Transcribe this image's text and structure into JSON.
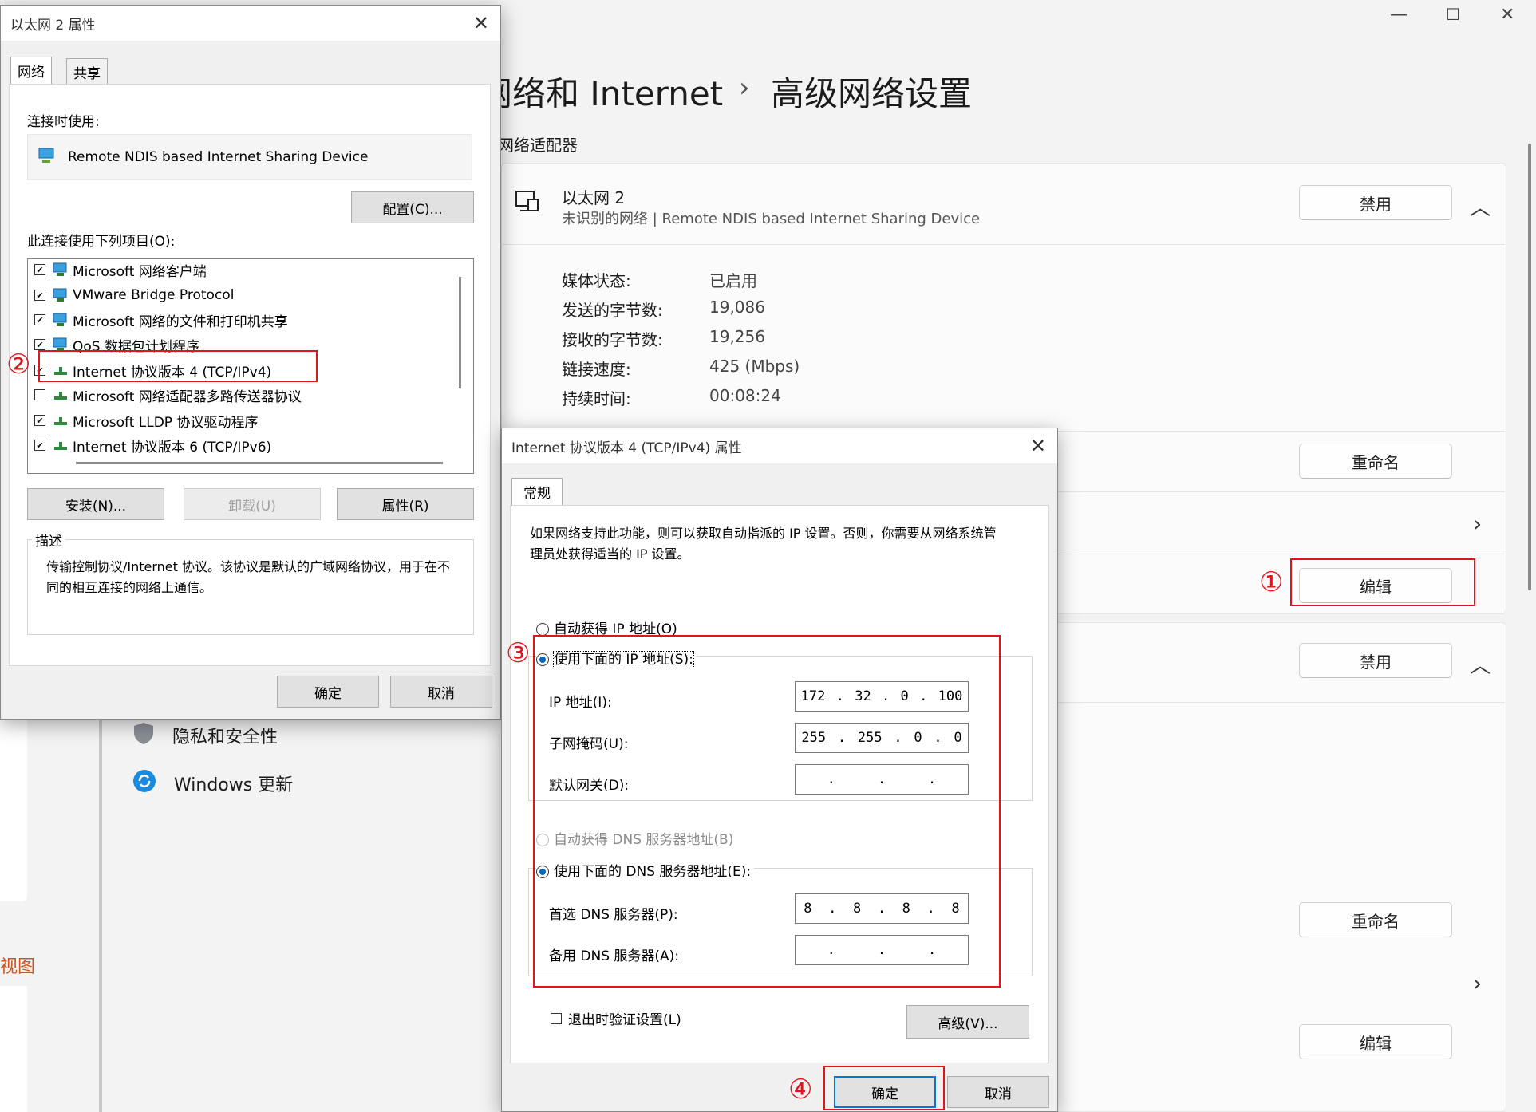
{
  "settings": {
    "window_controls": {
      "minimize": "—",
      "maximize": "☐",
      "close": "✕"
    },
    "breadcrumb": {
      "parent": "网络和 Internet",
      "separator": "›",
      "current": "高级网络设置"
    },
    "section_title": "网络适配器",
    "adapter1": {
      "name": "以太网 2",
      "subtitle": "未识别的网络 | Remote NDIS based Internet Sharing Device",
      "disable_label": "禁用",
      "properties": [
        {
          "label": "媒体状态:",
          "value": "已启用"
        },
        {
          "label": "发送的字节数:",
          "value": "19,086"
        },
        {
          "label": "接收的字节数:",
          "value": "19,256"
        },
        {
          "label": "链接速度:",
          "value": "425 (Mbps)"
        },
        {
          "label": "持续时间:",
          "value": "00:08:24"
        }
      ],
      "rename_label": "重命名",
      "edit_label": "编辑"
    },
    "adapter2": {
      "disable_label": "禁用",
      "rename_label": "重命名",
      "edit_label": "编辑"
    },
    "nav": [
      {
        "label": "隐私和安全性",
        "icon": "shield-icon"
      },
      {
        "label": "Windows 更新",
        "icon": "update-icon"
      }
    ],
    "left_partial_text": "视图"
  },
  "ethernet_dialog": {
    "title": "以太网 2 属性",
    "tabs": [
      "网络",
      "共享"
    ],
    "connect_using_label": "连接时使用:",
    "device_name": "Remote NDIS based Internet Sharing Device",
    "configure_label": "配置(C)...",
    "items_label": "此连接使用下列项目(O):",
    "items": [
      {
        "checked": true,
        "label": "Microsoft 网络客户端"
      },
      {
        "checked": true,
        "label": "VMware Bridge Protocol"
      },
      {
        "checked": true,
        "label": "Microsoft 网络的文件和打印机共享"
      },
      {
        "checked": true,
        "label": "QoS 数据包计划程序"
      },
      {
        "checked": true,
        "label": "Internet 协议版本 4 (TCP/IPv4)"
      },
      {
        "checked": false,
        "label": "Microsoft 网络适配器多路传送器协议"
      },
      {
        "checked": true,
        "label": "Microsoft LLDP 协议驱动程序"
      },
      {
        "checked": true,
        "label": "Internet 协议版本 6 (TCP/IPv6)"
      }
    ],
    "install_label": "安装(N)...",
    "uninstall_label": "卸载(U)",
    "properties_label": "属性(R)",
    "description_title": "描述",
    "description_text": "传输控制协议/Internet 协议。该协议是默认的广域网络协议，用于在不同的相互连接的网络上通信。",
    "ok_label": "确定",
    "cancel_label": "取消"
  },
  "ipv4_dialog": {
    "title": "Internet 协议版本 4 (TCP/IPv4) 属性",
    "tab": "常规",
    "intro": "如果网络支持此功能，则可以获取自动指派的 IP 设置。否则，你需要从网络系统管理员处获得适当的 IP 设置。",
    "auto_ip_label": "自动获得 IP 地址(O)",
    "manual_ip_label": "使用下面的 IP 地址(S):",
    "ip_label": "IP 地址(I):",
    "ip_value": [
      "172",
      "32",
      "0",
      "100"
    ],
    "mask_label": "子网掩码(U):",
    "mask_value": [
      "255",
      "255",
      "0",
      "0"
    ],
    "gateway_label": "默认网关(D):",
    "gateway_value": [
      "",
      "",
      "",
      ""
    ],
    "auto_dns_label": "自动获得 DNS 服务器地址(B)",
    "manual_dns_label": "使用下面的 DNS 服务器地址(E):",
    "dns1_label": "首选 DNS 服务器(P):",
    "dns1_value": [
      "8",
      "8",
      "8",
      "8"
    ],
    "dns2_label": "备用 DNS 服务器(A):",
    "dns2_value": [
      "",
      "",
      "",
      ""
    ],
    "validate_label": "退出时验证设置(L)",
    "advanced_label": "高级(V)...",
    "ok_label": "确定",
    "cancel_label": "取消"
  },
  "annotations": {
    "step1": "①",
    "step2": "②",
    "step3": "③",
    "step4": "④",
    "color": "#e0141e"
  }
}
